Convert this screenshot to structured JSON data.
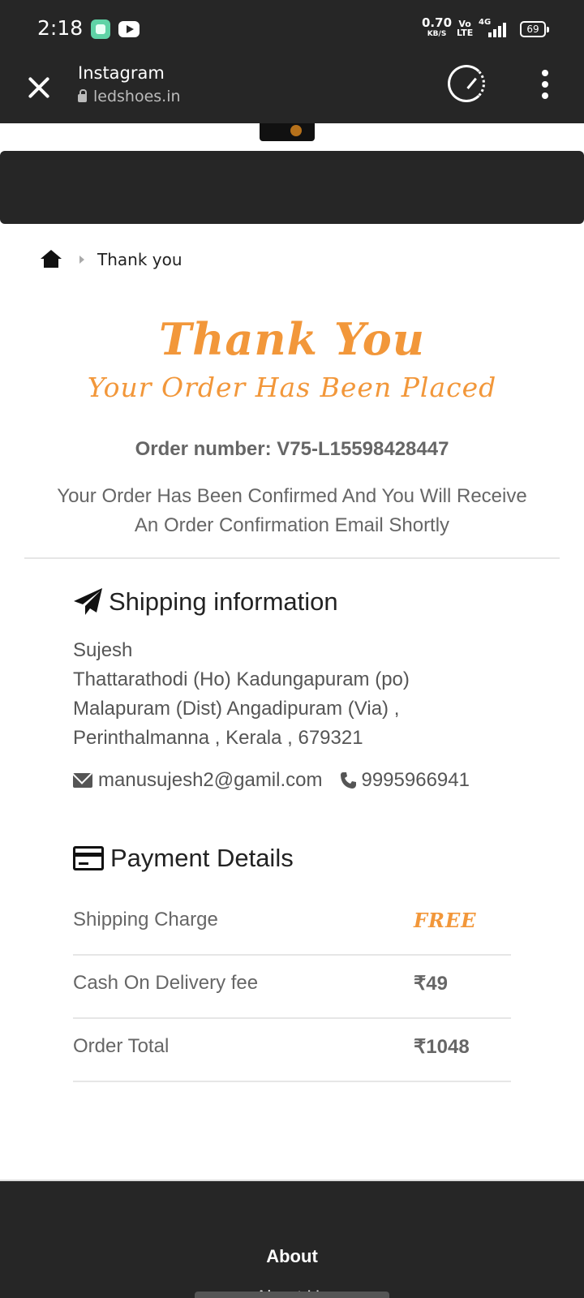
{
  "status_bar": {
    "time": "2:18",
    "net_speed_value": "0.70",
    "net_speed_unit": "KB/S",
    "volte_top": "Vo",
    "volte_bottom": "LTE",
    "network": "4G",
    "battery": "69"
  },
  "browser": {
    "title": "Instagram",
    "url": "ledshoes.in"
  },
  "breadcrumb": {
    "current": "Thank you"
  },
  "thank_you": {
    "title": "Thank You",
    "subtitle": "Your Order Has Been Placed",
    "order_number": "Order number: V75-L15598428447",
    "message_line1": "Your Order Has Been Confirmed And You Will Receive",
    "message_line2": "An Order Confirmation Email Shortly"
  },
  "shipping": {
    "heading": "Shipping information",
    "name": "Sujesh",
    "address_line1": "Thattarathodi (Ho) Kadungapuram (po)",
    "address_line2": "Malapuram (Dist) Angadipuram (Via) ,",
    "address_line3": "Perinthalmanna , Kerala , 679321",
    "email": "manusujesh2@gamil.com",
    "phone": "9995966941"
  },
  "payment": {
    "heading": "Payment Details",
    "rows": [
      {
        "label": "Shipping Charge",
        "value": "FREE"
      },
      {
        "label": "Cash On Delivery fee",
        "value": "₹49"
      },
      {
        "label": "Order Total",
        "value": "₹1048"
      }
    ]
  },
  "footer": {
    "about": "About",
    "link": "About Us"
  },
  "colors": {
    "accent": "#f2973a",
    "dark": "#262626"
  }
}
